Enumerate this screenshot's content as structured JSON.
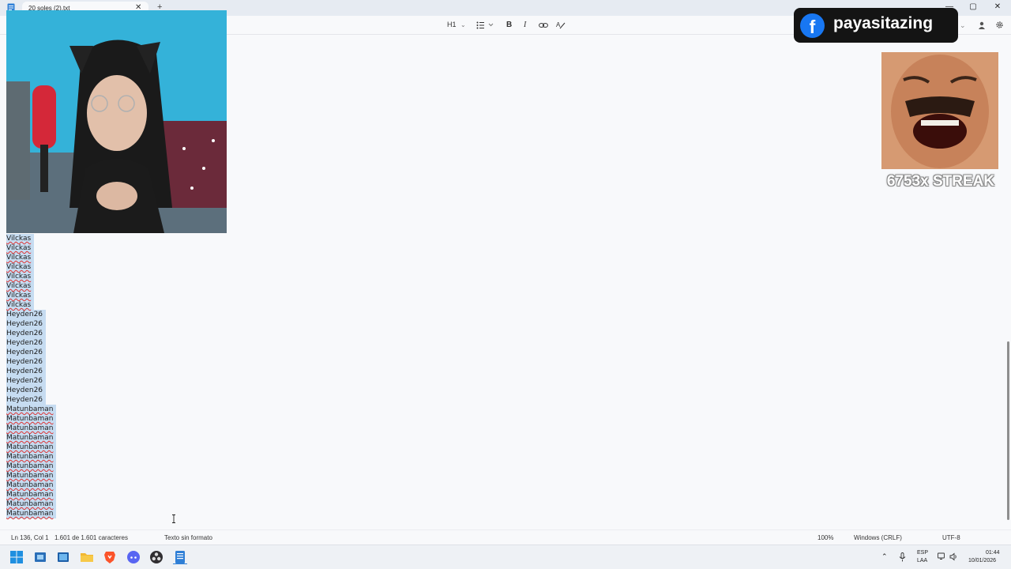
{
  "tab": {
    "title": "20 soles (2).txt",
    "close_glyph": "✕",
    "new_glyph": "+"
  },
  "window_controls": {
    "minimize": "—",
    "maximize": "▢",
    "close": "✕"
  },
  "format_bar": {
    "heading": "H1",
    "bold": "B",
    "italic": "I",
    "icons": [
      "chevron-down-icon",
      "list-icon",
      "link-icon",
      "clear-format-icon",
      "account-icon",
      "settings-icon"
    ]
  },
  "editor": {
    "lines": [
      {
        "text": "Vilckas",
        "misspelled": true
      },
      {
        "text": "Vilckas",
        "misspelled": true
      },
      {
        "text": "Vilckas",
        "misspelled": true
      },
      {
        "text": "Vilckas",
        "misspelled": true
      },
      {
        "text": "Vilckas",
        "misspelled": true
      },
      {
        "text": "Vilckas",
        "misspelled": true
      },
      {
        "text": "Vilckas",
        "misspelled": true
      },
      {
        "text": "Vilckas",
        "misspelled": true
      },
      {
        "text": "Heyden26",
        "misspelled": false
      },
      {
        "text": "Heyden26",
        "misspelled": false
      },
      {
        "text": "Heyden26",
        "misspelled": false
      },
      {
        "text": "Heyden26",
        "misspelled": false
      },
      {
        "text": "Heyden26",
        "misspelled": false
      },
      {
        "text": "Heyden26",
        "misspelled": false
      },
      {
        "text": "Heyden26",
        "misspelled": false
      },
      {
        "text": "Heyden26",
        "misspelled": false
      },
      {
        "text": "Heyden26",
        "misspelled": false
      },
      {
        "text": "Heyden26",
        "misspelled": false
      },
      {
        "text": "Matunbaman",
        "misspelled": true
      },
      {
        "text": "Matunbaman",
        "misspelled": true
      },
      {
        "text": "Matunbaman",
        "misspelled": true
      },
      {
        "text": "Matunbaman",
        "misspelled": true
      },
      {
        "text": "Matunbaman",
        "misspelled": true
      },
      {
        "text": "Matunbaman",
        "misspelled": true
      },
      {
        "text": "Matunbaman",
        "misspelled": true
      },
      {
        "text": "Matunbaman",
        "misspelled": true
      },
      {
        "text": "Matunbaman",
        "misspelled": true
      },
      {
        "text": "Matunbaman",
        "misspelled": true
      },
      {
        "text": "Matunbaman",
        "misspelled": true
      },
      {
        "text": "Matunbaman",
        "misspelled": true
      }
    ],
    "selection_color": "#c6dcf1"
  },
  "status_bar": {
    "position": "Ln 136, Col 1",
    "char_count": "1.601 de 1.601 caracteres",
    "format": "Texto sin formato",
    "zoom": "100%",
    "line_ending": "Windows (CRLF)",
    "encoding": "UTF-8"
  },
  "overlays": {
    "facebook_handle": "payasitazing",
    "streak_text": "6753x STREAK",
    "facebook_color": "#1877f2"
  },
  "taskbar": {
    "icons": [
      "windows-start-icon",
      "task-view-icon",
      "widgets-icon",
      "file-explorer-icon",
      "brave-browser-icon",
      "discord-icon",
      "obs-icon",
      "notepad-icon"
    ],
    "tray": {
      "language": "ESP",
      "layout": "LAA",
      "time": "01:44",
      "date": "10/01/2026"
    }
  }
}
